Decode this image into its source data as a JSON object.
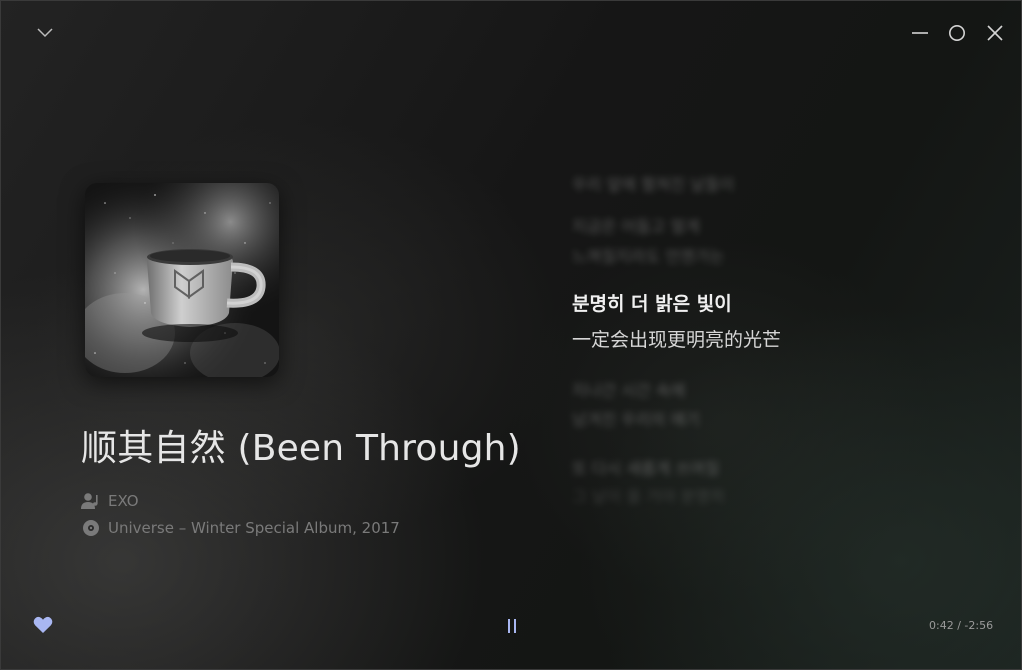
{
  "window": {
    "collapse_icon": "chevron-down-icon",
    "minimize_icon": "minimize-icon",
    "maximize_icon": "maximize-icon",
    "close_icon": "close-icon"
  },
  "song": {
    "title": "顺其自然 (Been Through)",
    "artist": "EXO",
    "album": "Universe – Winter Special Album, 2017",
    "artist_icon": "artist-icon",
    "album_icon": "disc-icon"
  },
  "lyrics": {
    "lines": [
      "우리 앞에 펼쳐진 날들이",
      "지금은 어둡고 멀게",
      "느껴질지라도 언젠가는",
      "분명히 더 밝은 빛이",
      "一定会出现更明亮的光芒",
      "지나간 시간 속에",
      "남겨진 우리의 얘기",
      "또 다시 새롭게 쓰여질",
      "그 날이 올 거야 분명히"
    ],
    "active_index": 3
  },
  "player": {
    "liked": true,
    "like_icon": "heart-icon",
    "pause_icon": "pause-icon",
    "time": "0:42 / -2:56"
  },
  "colors": {
    "accent": "#a9b7f2",
    "text_primary": "#e6e6e6",
    "text_muted": "#7a7a7a"
  }
}
